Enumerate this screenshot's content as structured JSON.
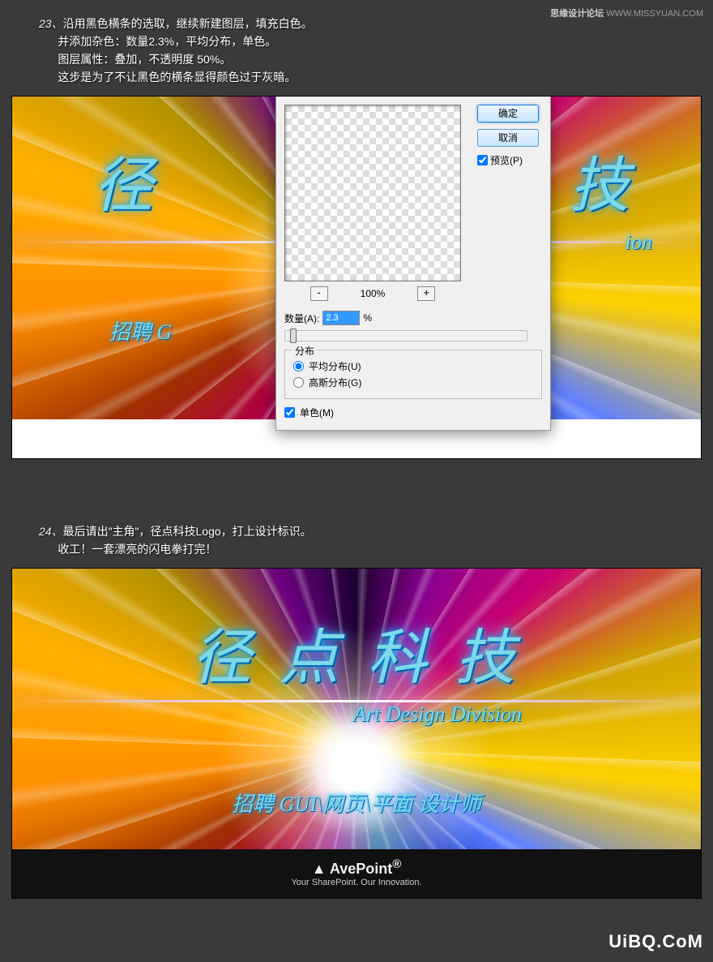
{
  "watermark": {
    "site_cn": "思缘设计论坛",
    "site_url": "WWW.MISSYUAN.COM",
    "bottom": "UiBQ.CoM"
  },
  "step23": {
    "num": "23、",
    "line1": "沿用黑色横条的选取，继续新建图层，填充白色。",
    "line2": "并添加杂色：数量2.3%，平均分布，单色。",
    "line3": "图层属性：叠加，不透明度 50%。",
    "line4": "这步是为了不让黑色的横条显得颜色过于灰暗。"
  },
  "step24": {
    "num": "24、",
    "line1": "最后请出\"主角\"，径点科技Logo，打上设计标识。",
    "line2": "收工！一套漂亮的闪电拳打完！"
  },
  "banner": {
    "title_partial": "径",
    "title_partial2": "技",
    "subtitle_partial": "ion",
    "hire_partial": "招聘 G",
    "title": "径 点 科 技",
    "subtitle": "Art Design Division",
    "hire": "招聘 GUI\\网页\\平面 设计师",
    "logo_name": "AvePoint",
    "logo_tag": "Your SharePoint. Our Innovation.",
    "reg": "®"
  },
  "dialog": {
    "ok": "确定",
    "cancel": "取消",
    "preview": "预览(P)",
    "zoom": "100%",
    "amount_label": "数量(A):",
    "amount_value": "2.3",
    "amount_unit": "%",
    "dist_legend": "分布",
    "dist_uniform": "平均分布(U)",
    "dist_gaussian": "高斯分布(G)",
    "mono": "单色(M)"
  }
}
